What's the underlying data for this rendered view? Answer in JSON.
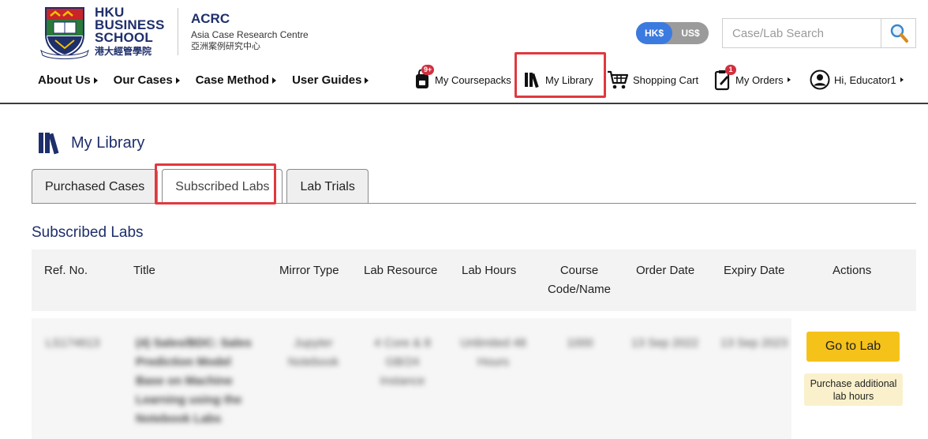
{
  "brand": {
    "hku_line1": "HKU",
    "hku_line2": "BUSINESS",
    "hku_line3": "SCHOOL",
    "hku_chinese": "港大經管學院",
    "acrc_title": "ACRC",
    "acrc_subtitle": "Asia Case Research Centre",
    "acrc_chinese": "亞洲案例研究中心"
  },
  "currency": {
    "options": [
      "HK$",
      "US$"
    ],
    "selected": "HK$",
    "active_color": "#3b7be0"
  },
  "search": {
    "placeholder": "Case/Lab Search",
    "value": "",
    "icon": "magnifier-icon"
  },
  "main_nav": [
    {
      "label": "About Us"
    },
    {
      "label": "Our Cases"
    },
    {
      "label": "Case Method"
    },
    {
      "label": "User Guides"
    }
  ],
  "user_nav": {
    "coursepacks": {
      "label": "My Coursepacks",
      "badge": "9+",
      "icon": "backpack-icon"
    },
    "library": {
      "label": "My Library",
      "icon": "books-icon"
    },
    "cart": {
      "label": "Shopping Cart",
      "icon": "cart-icon"
    },
    "orders": {
      "label": "My Orders",
      "badge": "1",
      "icon": "clipboard-icon"
    },
    "account": {
      "label": "Hi, Educator1",
      "icon": "user-icon"
    }
  },
  "page": {
    "title": "My Library",
    "icon": "books-icon"
  },
  "tabs": [
    {
      "label": "Purchased Cases",
      "active": false
    },
    {
      "label": "Subscribed Labs",
      "active": true
    },
    {
      "label": "Lab Trials",
      "active": false
    }
  ],
  "section": {
    "title": "Subscribed Labs"
  },
  "table": {
    "headers": {
      "ref": "Ref. No.",
      "title": "Title",
      "mirror": "Mirror Type",
      "resource": "Lab Resource",
      "hours": "Lab Hours",
      "course_1": "Course",
      "course_2": "Code/Name",
      "order_date": "Order Date",
      "expiry_date": "Expiry Date",
      "actions": "Actions"
    },
    "rows": [
      {
        "ref": "LS174613",
        "title_lines": [
          "(4) Sales/BDC: Sales",
          "Prediction Model",
          "Base on Machine",
          "Learning using the",
          "Notebook Labs"
        ],
        "mirror_lines": [
          "Jupyter",
          "Notebook"
        ],
        "resource_lines": [
          "4 Core & 8",
          "GB/24",
          "Instance"
        ],
        "hours_lines": [
          "Unlimited 48",
          "Hours"
        ],
        "course": "1000",
        "order_date": "13 Sep 2022",
        "expiry_date": "13 Sep 2023",
        "go_label": "Go to Lab",
        "purchase_line1": "Purchase additional",
        "purchase_line2": "lab hours"
      }
    ]
  },
  "colors": {
    "brand_navy": "#1e2f6b",
    "highlight_red": "#e0393e",
    "action_yellow": "#f5c21a",
    "badge_red": "#d12f3f"
  }
}
